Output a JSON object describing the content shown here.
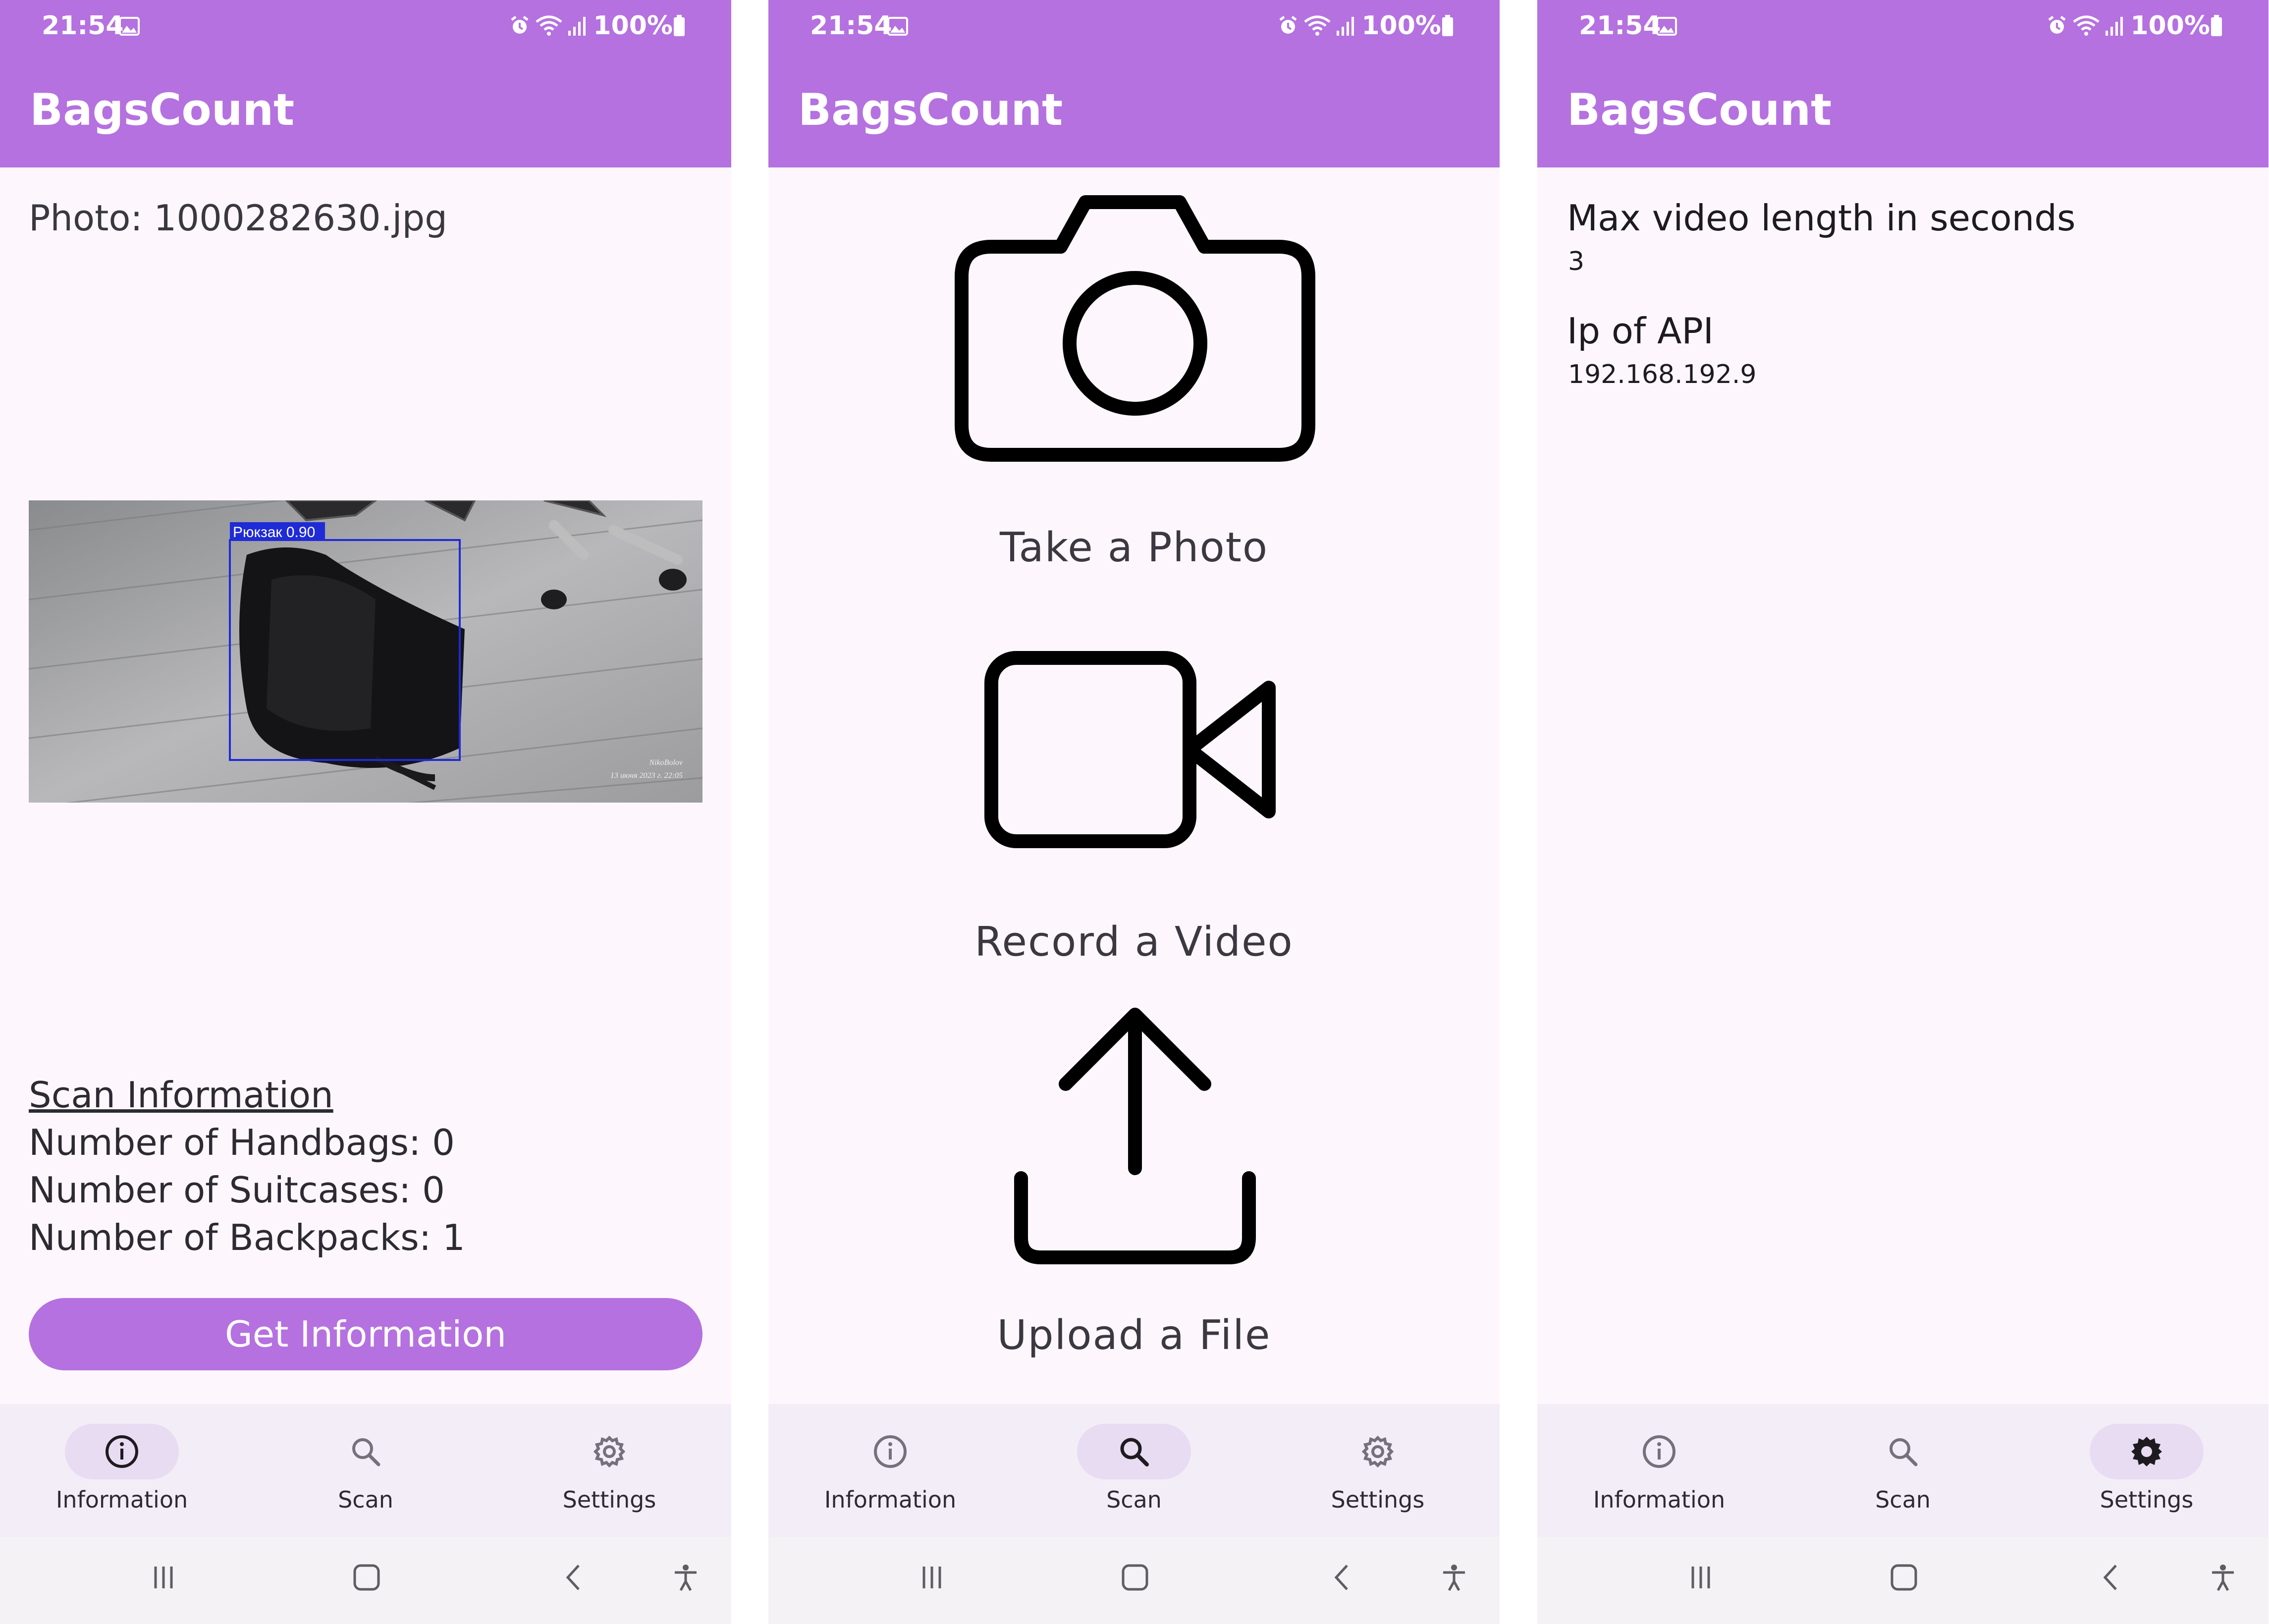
{
  "status_bar": {
    "time": "21:54",
    "battery": "100%"
  },
  "app": {
    "title": "BagsCount"
  },
  "information_screen": {
    "photo_label": "Photo: 1000282630.jpg",
    "detection_label": "Рюкзак 0.90",
    "watermark_line1": "NikoBolov",
    "watermark_line2": "13 июня 2023 г. 22:05",
    "scan_info_title": "Scan Information",
    "handbags": "Number of Handbags: 0",
    "suitcases": "Number of Suitcases: 0",
    "backpacks": "Number of Backpacks: 1",
    "button_label": "Get Information"
  },
  "scan_screen": {
    "take_photo": "Take a Photo",
    "record_video": "Record a Video",
    "upload_file": "Upload a File"
  },
  "settings_screen": {
    "max_video_title": "Max video length in seconds",
    "max_video_value": "3",
    "ip_title": "Ip of API",
    "ip_value": "192.168.192.9"
  },
  "nav": {
    "information": "Information",
    "scan": "Scan",
    "settings": "Settings"
  },
  "colors": {
    "accent": "#b571e0",
    "background": "#fdf7fd",
    "nav_background": "#f3edf7",
    "nav_active_pill": "#e8dcf2",
    "detection_box": "#0000ff"
  },
  "icons": {
    "status": [
      "photo-icon",
      "alarm-icon",
      "wifi-icon",
      "signal-icon",
      "battery-icon"
    ],
    "actions": [
      "camera-icon",
      "video-camera-icon",
      "upload-icon"
    ],
    "nav": [
      "info-icon",
      "search-icon",
      "gear-icon"
    ],
    "system": [
      "recent-apps-icon",
      "home-icon",
      "back-icon",
      "accessibility-icon"
    ]
  }
}
